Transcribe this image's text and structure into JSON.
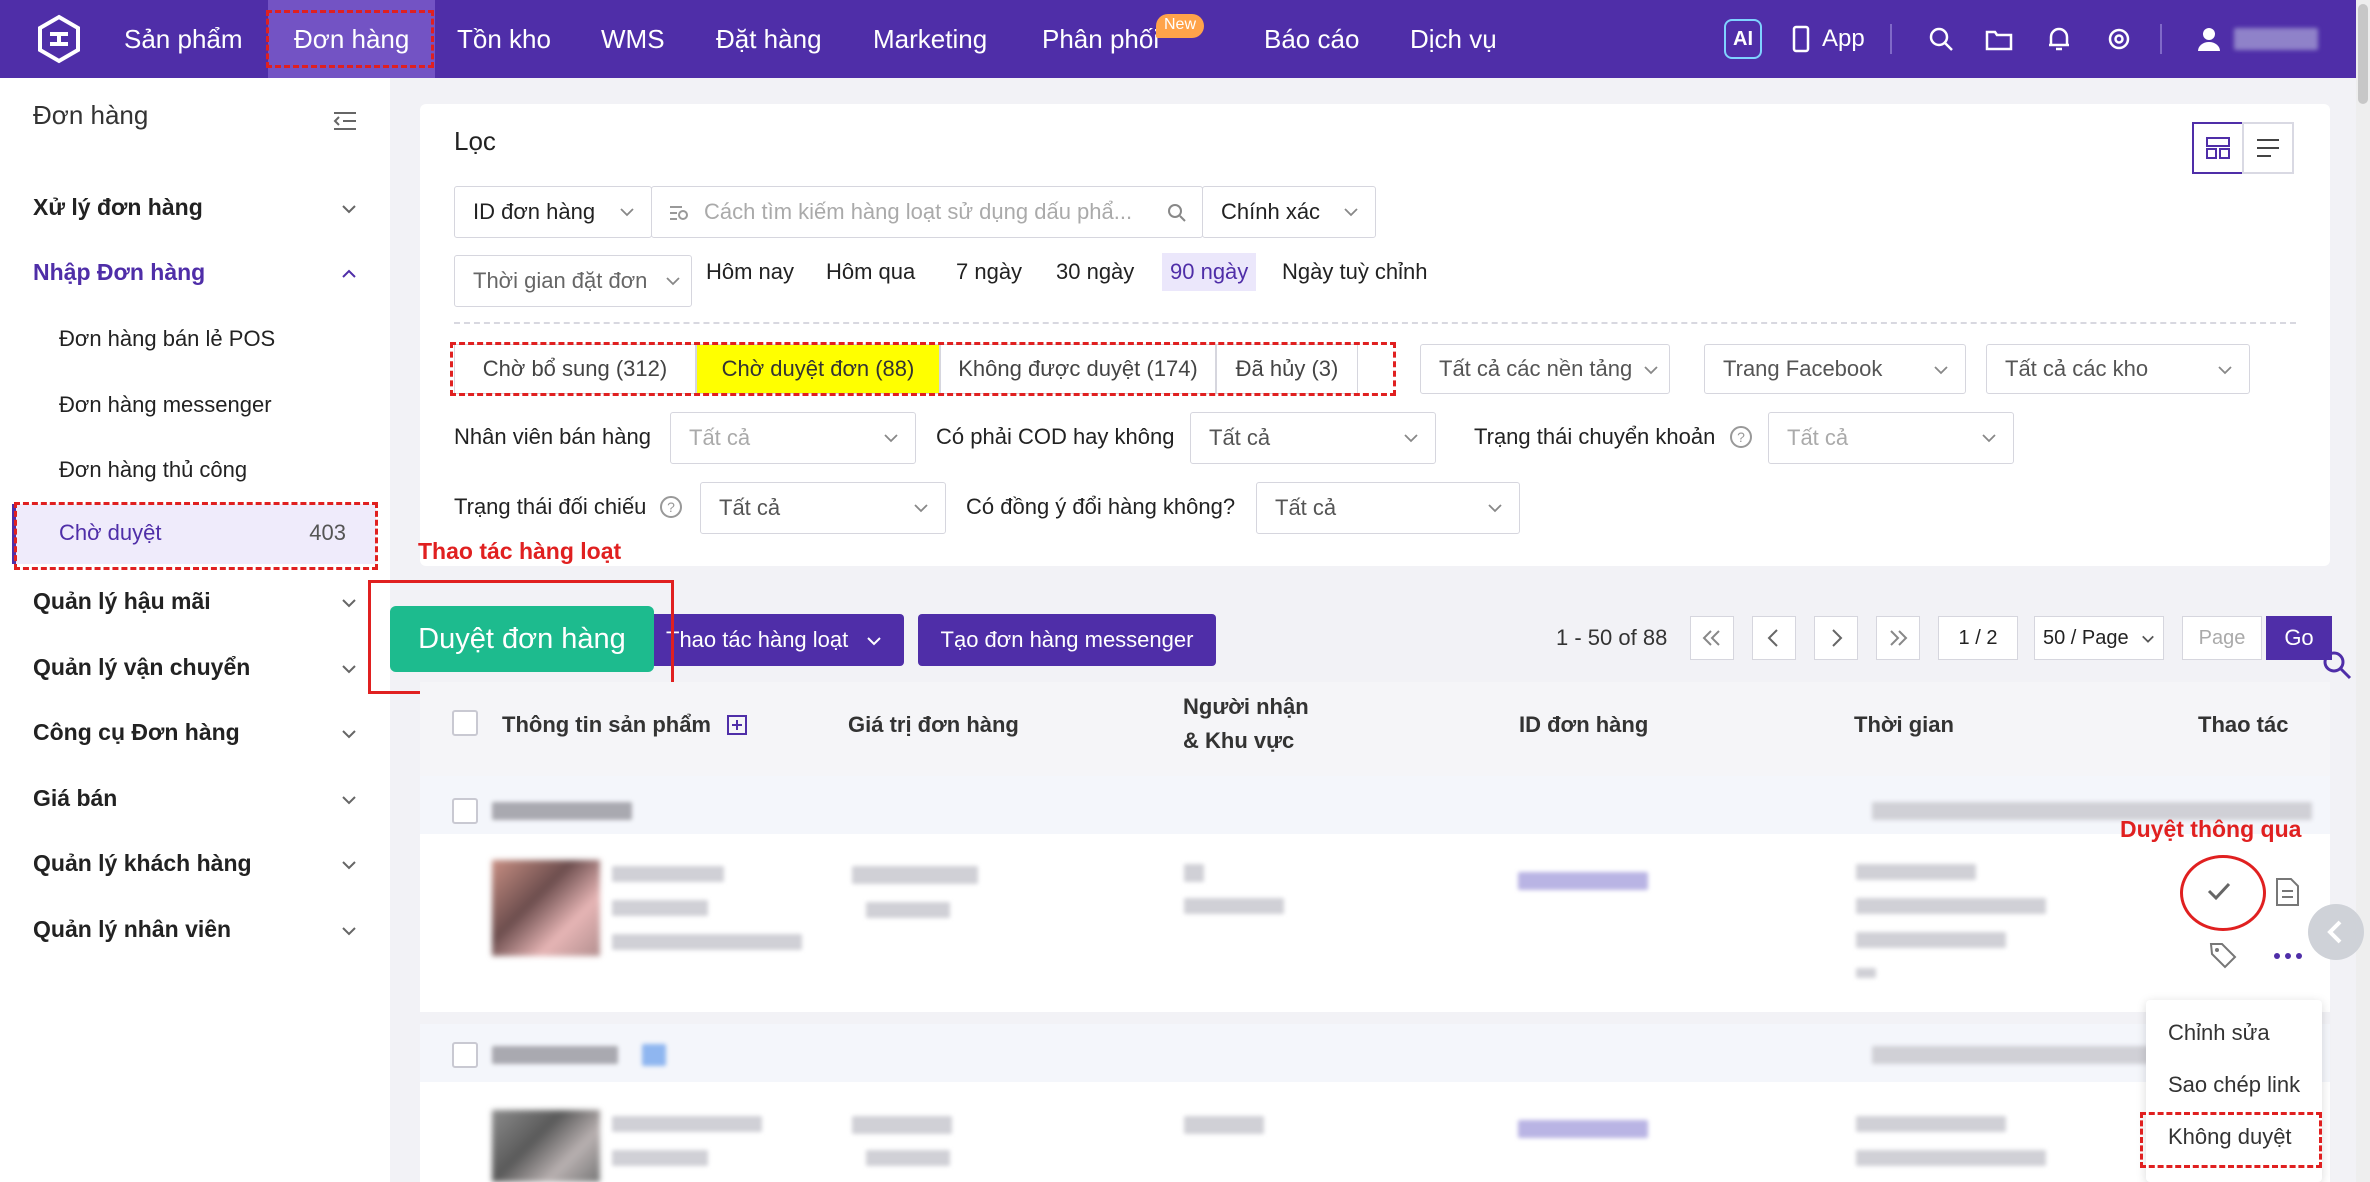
{
  "topnav": {
    "items": [
      "Sản phẩm",
      "Đơn hàng",
      "Tồn kho",
      "WMS",
      "Đặt hàng",
      "Marketing",
      "Phân phối",
      "Báo cáo",
      "Dịch vụ"
    ],
    "new_badge": "New",
    "ai_label": "AI",
    "app_label": "App",
    "colors": {
      "bar": "#4f2ea8",
      "active": "#7353c4",
      "highlight": "#e02020"
    }
  },
  "sidebar": {
    "title": "Đơn hàng",
    "sections": [
      "Xử lý đơn hàng",
      "Nhập Đơn hàng",
      "Quản lý hậu mãi",
      "Quản lý vận chuyển",
      "Công cụ Đơn hàng",
      "Giá bán",
      "Quản lý khách hàng",
      "Quản lý nhân viên"
    ],
    "sub_items": [
      "Đơn hàng bán lẻ POS",
      "Đơn hàng messenger",
      "Đơn hàng thủ công",
      "Chờ duyệt"
    ],
    "active_count": "403"
  },
  "filter": {
    "title": "Lọc",
    "search_field": "ID đơn hàng",
    "search_placeholder": "Cách tìm kiếm hàng loạt sử dụng dấu phẩ...",
    "match_mode": "Chính xác",
    "time_select": "Thời gian đặt đơn",
    "date_presets": [
      "Hôm nay",
      "Hôm qua",
      "7 ngày",
      "30 ngày",
      "90 ngày",
      "Ngày tuỳ chỉnh"
    ],
    "status_tabs": [
      "Chờ bổ sung (312)",
      "Chờ duyệt đơn (88)",
      "Không được duyệt (174)",
      "Đã hủy (3)"
    ],
    "platform": "Tất cả các nền tảng",
    "page": "Trang Facebook",
    "warehouse": "Tất cả các kho",
    "labels": {
      "sales_staff": "Nhân viên bán hàng",
      "cod": "Có phải COD hay không",
      "transfer_status": "Trạng thái chuyển khoản",
      "reconcile": "Trạng thái đối chiếu",
      "exchange": "Có đồng ý đổi hàng không?"
    },
    "all": "Tất cả"
  },
  "actions": {
    "annotation_batch": "Thao tác hàng loạt",
    "approve_btn": "Duyệt đơn hàng",
    "batch_btn": "Thao tác hàng loạt",
    "messenger_btn": "Tạo đơn hàng messenger",
    "range": "1 - 50 of 88",
    "page_input": "1 / 2",
    "per_page": "50 / Page",
    "page_placeholder": "Page",
    "go": "Go"
  },
  "table": {
    "headers": {
      "product": "Thông tin sản phẩm",
      "value": "Giá trị đơn hàng",
      "recipient_line1": "Người nhận",
      "recipient_line2": "& Khu vực",
      "order_id": "ID đơn hàng",
      "time": "Thời gian",
      "action": "Thao tác"
    },
    "annotation_approve": "Duyệt thông qua"
  },
  "context_menu": {
    "items": [
      "Chỉnh sửa",
      "Sao chép link",
      "Không duyệt"
    ]
  }
}
